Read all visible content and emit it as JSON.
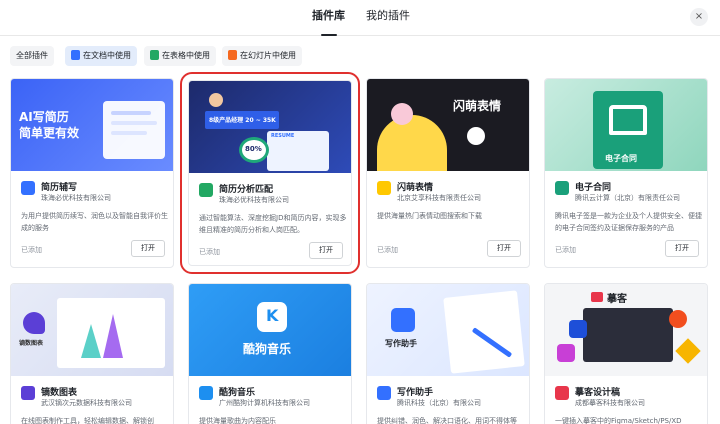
{
  "tabs": [
    {
      "label": "插件库",
      "active": true
    },
    {
      "label": "我的插件",
      "active": false
    }
  ],
  "close_label": "×",
  "filters": [
    {
      "label": "全部插件",
      "active": false,
      "icon": ""
    },
    {
      "label": "在文档中使用",
      "active": true,
      "icon": "doc-icon",
      "color": "#3370ff"
    },
    {
      "label": "在表格中使用",
      "active": false,
      "icon": "sheet-icon",
      "color": "#22a863"
    },
    {
      "label": "在幻灯片中使用",
      "active": false,
      "icon": "slides-icon",
      "color": "#f5681f"
    }
  ],
  "cards": [
    {
      "name": "简历辅写",
      "company": "珠海必优科技有限公司",
      "desc": "为用户提供简历续写、润色以及智能自我评价生成的服务",
      "added": "已添加",
      "action": "打开",
      "banner_text": "AI写简历\n简单更有效",
      "icon": "resume-writer-icon",
      "icon_color": "#3370ff",
      "selected": false
    },
    {
      "name": "简历分析匹配",
      "company": "珠海必优科技有限公司",
      "desc": "通过智能算法、深度挖掘JD和简历内容，实现多维且精准的简历分析和人岗匹配。",
      "added": "已添加",
      "action": "打开",
      "banner_text": "8级产品经理  20 ~ 35K",
      "banner_badge": "80%",
      "banner_tag": "RESUME",
      "icon": "resume-match-icon",
      "icon_color": "#22a863",
      "selected": true
    },
    {
      "name": "闪萌表情",
      "company": "北京艾享科技有限责任公司",
      "desc": "提供海量热门表情动图搜索和下载",
      "added": "已添加",
      "action": "打开",
      "banner_text": "闪萌表情",
      "icon": "lightning-icon",
      "icon_color": "#ffc800",
      "selected": false
    },
    {
      "name": "电子合同",
      "company": "腾讯云计算（北京）有限责任公司",
      "desc": "腾讯电子签是一款为企业及个人提供安全、便捷的电子合同签约及证据保存服务的产品",
      "added": "已添加",
      "action": "打开",
      "banner_text": "电子合同",
      "icon": "contract-icon",
      "icon_color": "#1aa07a",
      "selected": false
    },
    {
      "name": "镝数图表",
      "company": "武汉镝次元数据科技有限公司",
      "desc": "在线图表制作工具，轻松编辑数据、解锁创",
      "added": "",
      "action": "",
      "banner_text": "镝数图表",
      "icon": "dycharts-icon",
      "icon_color": "#5b3fd6",
      "selected": false
    },
    {
      "name": "酷狗音乐",
      "company": "广州酷狗计算机科技有限公司",
      "desc": "提供海量歌曲为内容配乐",
      "added": "",
      "action": "",
      "banner_text": "酷狗音乐",
      "icon": "kugou-icon",
      "icon_color": "#1d8ff0",
      "selected": false
    },
    {
      "name": "写作助手",
      "company": "腾讯科技（北京）有限公司",
      "desc": "提供纠错、润色、解决口语化、用词不得体等",
      "added": "",
      "action": "",
      "banner_text": "写作助手",
      "icon": "pen-icon",
      "icon_color": "#3370ff",
      "selected": false
    },
    {
      "name": "摹客设计稿",
      "company": "成都摹客科技有限公司",
      "desc": "一键插入摹客中的Figma/Sketch/PS/XD",
      "added": "",
      "action": "",
      "banner_text": "摹客",
      "icon": "mockingbot-icon",
      "icon_color": "#e8364b",
      "selected": false
    }
  ]
}
